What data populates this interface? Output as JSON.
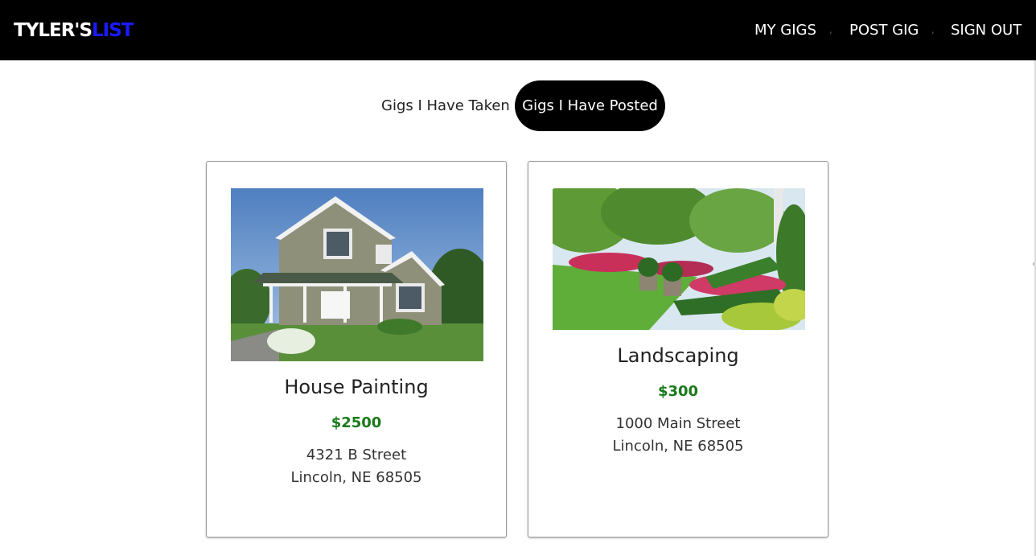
{
  "brand": {
    "part1": "TYLER'S",
    "part2": "LIST"
  },
  "nav": {
    "items": [
      {
        "label": "MY GIGS"
      },
      {
        "label": "POST GIG"
      },
      {
        "label": "SIGN OUT"
      }
    ],
    "separator": ","
  },
  "tabs": {
    "taken_label": "Gigs I Have Taken",
    "posted_label": "Gigs I Have Posted",
    "active": "posted"
  },
  "gigs": [
    {
      "title": "House Painting",
      "price": "$2500",
      "address_line1": "4321 B Street",
      "address_line2": "Lincoln, NE 68505",
      "image": "house-photo"
    },
    {
      "title": "Landscaping",
      "price": "$300",
      "address_line1": "1000 Main Street",
      "address_line2": "Lincoln, NE 68505",
      "image": "garden-photo"
    }
  ],
  "colors": {
    "navbar_bg": "#000000",
    "brand_accent": "#1a1aff",
    "price": "#1a7a1a",
    "active_tab_bg": "#000000"
  }
}
